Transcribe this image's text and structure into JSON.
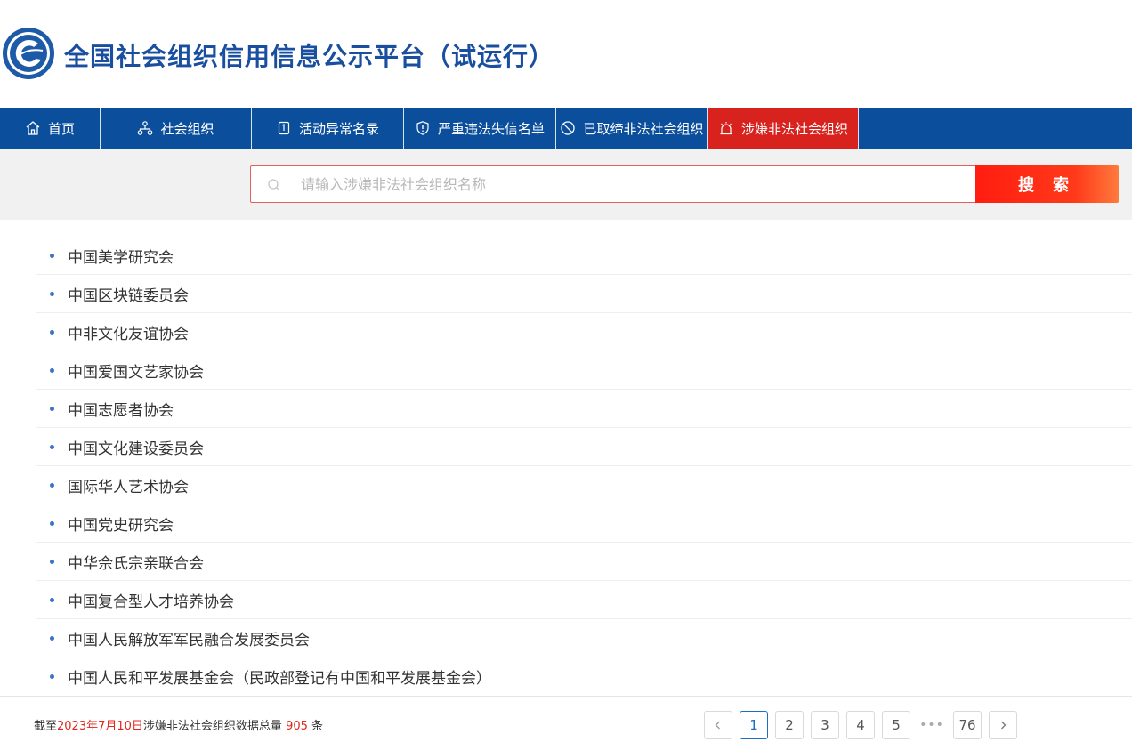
{
  "header": {
    "title": "全国社会组织信用信息公示平台（试运行）"
  },
  "nav": {
    "items": [
      {
        "label": "首页",
        "icon": "home-icon"
      },
      {
        "label": "社会组织",
        "icon": "org-icon"
      },
      {
        "label": "活动异常名录",
        "icon": "list-icon"
      },
      {
        "label": "严重违法失信名单",
        "icon": "shield-icon"
      },
      {
        "label": "已取缔非法社会组织",
        "icon": "ban-icon"
      },
      {
        "label": "涉嫌非法社会组织",
        "icon": "alarm-icon",
        "active": true
      }
    ]
  },
  "search": {
    "placeholder": "请输入涉嫌非法社会组织名称",
    "button_label": "搜 索"
  },
  "list": {
    "items": [
      "中国美学研究会",
      "中国区块链委员会",
      "中非文化友谊协会",
      "中国爱国文艺家协会",
      "中国志愿者协会",
      "中国文化建设委员会",
      "国际华人艺术协会",
      "中国党史研究会",
      "中华佘氏宗亲联合会",
      "中国复合型人才培养协会",
      "中国人民解放军军民融合发展委员会",
      "中国人民和平发展基金会（民政部登记有中国和平发展基金会）"
    ]
  },
  "footer": {
    "summary_prefix": "截至",
    "summary_date": "2023年7月10日",
    "summary_middle": "涉嫌非法社会组织数据总量 ",
    "summary_count": "905",
    "summary_suffix": " 条"
  },
  "pagination": {
    "pages": [
      "1",
      "2",
      "3",
      "4",
      "5"
    ],
    "current": "1",
    "ellipsis": "•••",
    "last": "76"
  },
  "colors": {
    "nav_bg": "#0b4f9c",
    "nav_active": "#d7221e",
    "title": "#1a4fa0",
    "accent_red": "#e0261c"
  }
}
